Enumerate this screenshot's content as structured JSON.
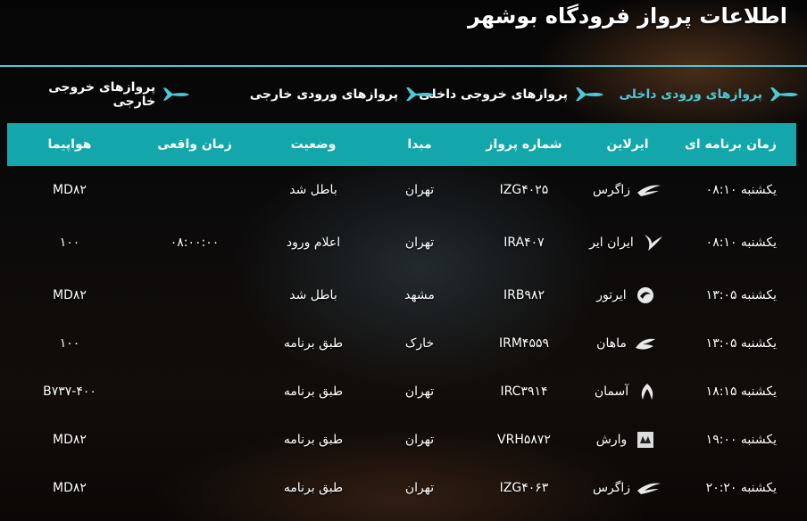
{
  "page_title": "اطلاعات پرواز فرودگاه بوشهر",
  "tabs": [
    {
      "label": "پروازهای ورودی داخلی",
      "active": true
    },
    {
      "label": "پروازهای خروجی داخلی",
      "active": false
    },
    {
      "label": "پروازهای ورودی خارجی",
      "active": false
    },
    {
      "label": "پروازهای خروجی خارجی",
      "active": false
    }
  ],
  "columns": {
    "scheduled": "زمان برنامه ای",
    "airline": "ایرلاین",
    "flight": "شماره پرواز",
    "origin": "مبدا",
    "status": "وضعیت",
    "actual": "زمان واقعی",
    "aircraft": "هواپیما"
  },
  "rows": [
    {
      "scheduled": "یکشنبه ۰۸:۱۰",
      "airline": "زاگرس",
      "logo_icon": "zagros-logo-icon",
      "flight": "IZG۴۰۲۵",
      "origin": "تهران",
      "status": "باطل شد",
      "actual": "",
      "aircraft": "MD۸۲"
    },
    {
      "scheduled": "یکشنبه ۰۸:۱۰",
      "airline": "ایران ایر",
      "logo_icon": "iranair-logo-icon",
      "flight": "IRA۴۰۷",
      "origin": "تهران",
      "status": "اعلام ورود",
      "actual": "۰۸:۰۰:۰۰",
      "aircraft": "۱۰۰"
    },
    {
      "scheduled": "یکشنبه ۱۳:۰۵",
      "airline": "ایرتور",
      "logo_icon": "airtour-logo-icon",
      "flight": "IRB۹۸۲",
      "origin": "مشهد",
      "status": "باطل شد",
      "actual": "",
      "aircraft": "MD۸۲"
    },
    {
      "scheduled": "یکشنبه ۱۳:۰۵",
      "airline": "ماهان",
      "logo_icon": "mahan-logo-icon",
      "flight": "IRM۴۵۵۹",
      "origin": "خارک",
      "status": "طبق برنامه",
      "actual": "",
      "aircraft": "۱۰۰"
    },
    {
      "scheduled": "یکشنبه ۱۸:۱۵",
      "airline": "آسمان",
      "logo_icon": "aseman-logo-icon",
      "flight": "IRC۳۹۱۴",
      "origin": "تهران",
      "status": "طبق برنامه",
      "actual": "",
      "aircraft": "B۷۳۷-۴۰۰"
    },
    {
      "scheduled": "یکشنبه ۱۹:۰۰",
      "airline": "وارش",
      "logo_icon": "varesh-logo-icon",
      "flight": "VRH۵۸۷۲",
      "origin": "تهران",
      "status": "طبق برنامه",
      "actual": "",
      "aircraft": "MD۸۲"
    },
    {
      "scheduled": "یکشنبه ۲۰:۲۰",
      "airline": "زاگرس",
      "logo_icon": "zagros-logo-icon",
      "flight": "IZG۴۰۶۳",
      "origin": "تهران",
      "status": "طبق برنامه",
      "actual": "",
      "aircraft": "MD۸۲"
    }
  ],
  "colors": {
    "accent": "#4cc9d8",
    "header_bg": "#13a7ab",
    "text": "#ffffff"
  }
}
